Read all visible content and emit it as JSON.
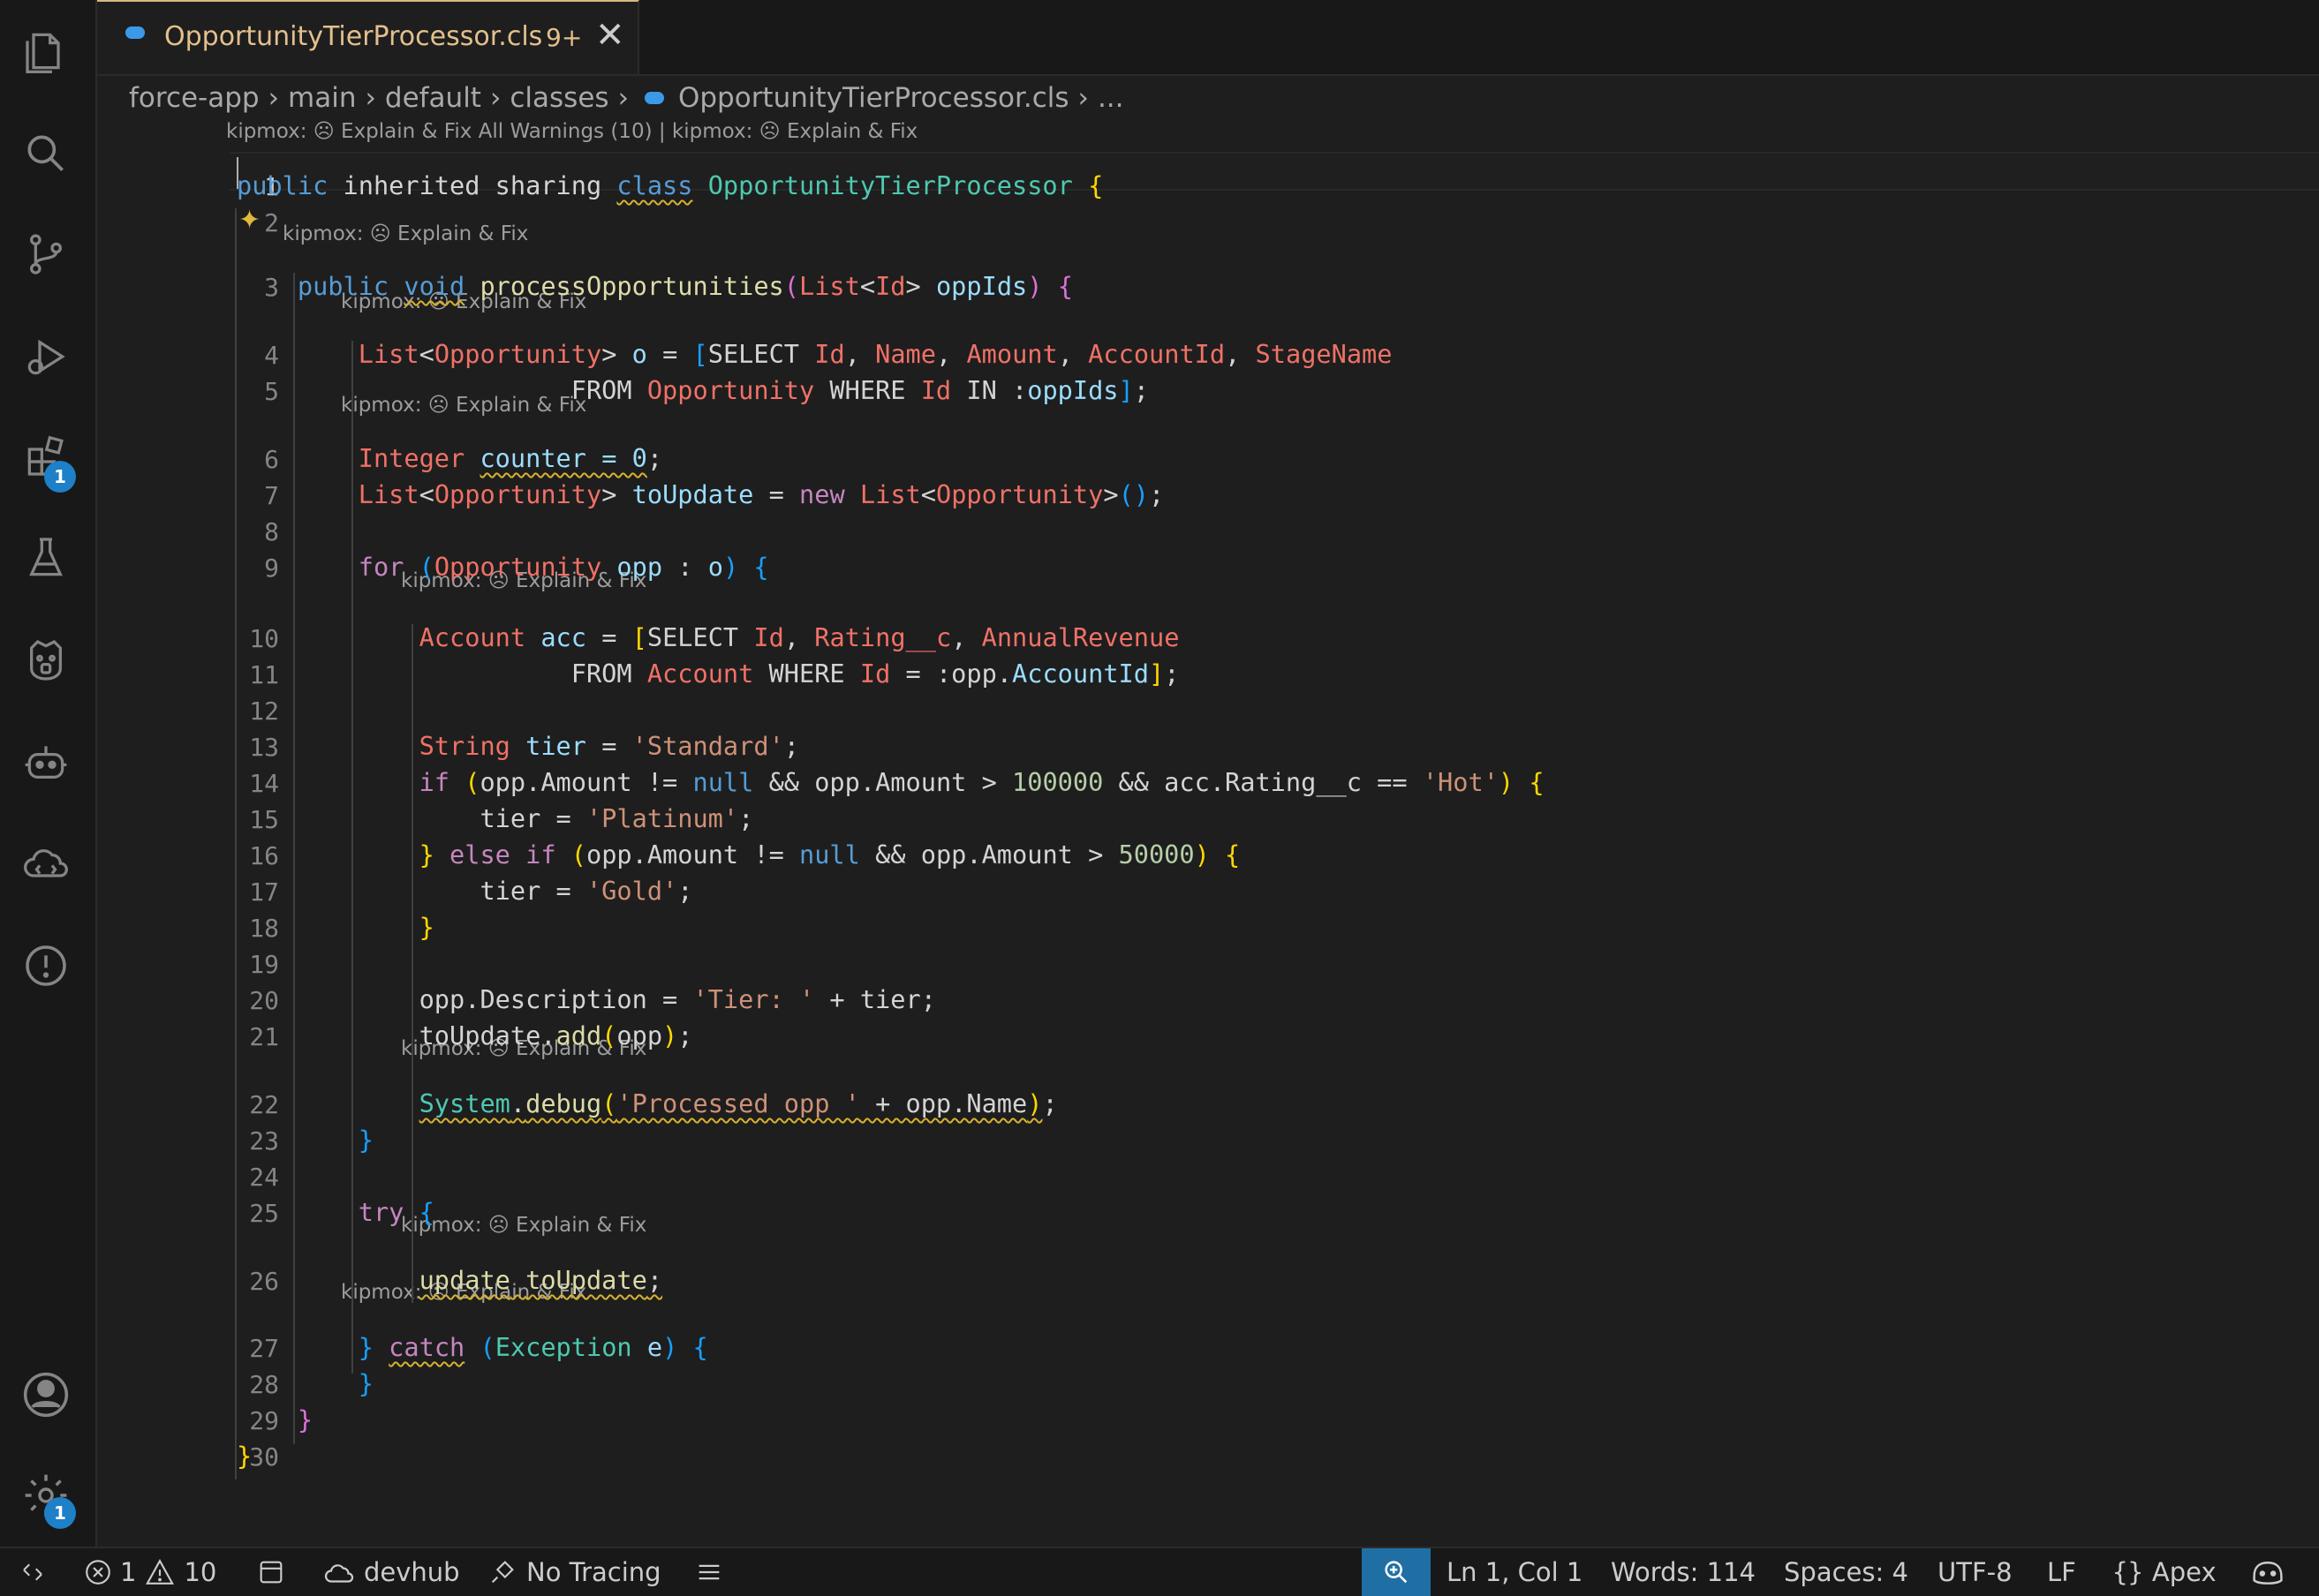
{
  "tab": {
    "filename": "OpportunityTierProcessor.cls",
    "problems": "9+",
    "close": "✕"
  },
  "breadcrumb": [
    "force-app",
    "main",
    "default",
    "classes",
    "OpportunityTierProcessor.cls",
    "..."
  ],
  "activity_badges": {
    "extensions": "1",
    "settings": "1"
  },
  "code_lens": {
    "top": "kipmox: ☹ Explain & Fix All Warnings (10) | kipmox: ☹ Explain & Fix",
    "fix": "kipmox: ☹ Explain & Fix"
  },
  "line_numbers": [
    "1",
    "2",
    "3",
    "4",
    "5",
    "6",
    "7",
    "8",
    "9",
    "10",
    "11",
    "12",
    "13",
    "14",
    "15",
    "16",
    "17",
    "18",
    "19",
    "20",
    "21",
    "22",
    "23",
    "24",
    "25",
    "26",
    "27",
    "28",
    "29",
    "30"
  ],
  "lines": [
    [
      [
        "public",
        "kw"
      ],
      [
        " inherited sharing ",
        ""
      ],
      [
        "class",
        "kw wv"
      ],
      [
        " ",
        ""
      ],
      [
        "OpportunityTierProcessor",
        "ty"
      ],
      [
        " ",
        ""
      ],
      [
        "{",
        "bk1"
      ]
    ],
    [],
    [
      [
        "    public ",
        "kw"
      ],
      [
        "void",
        "kw wv"
      ],
      [
        " ",
        ""
      ],
      [
        "processOpportunities",
        "fn"
      ],
      [
        "(",
        "bk2"
      ],
      [
        "List",
        "sf"
      ],
      [
        "<",
        ""
      ],
      [
        "Id",
        "sf"
      ],
      [
        "> ",
        ""
      ],
      [
        "oppIds",
        "var"
      ],
      [
        ")",
        "bk2"
      ],
      [
        " ",
        ""
      ],
      [
        "{",
        "bk2"
      ]
    ],
    [
      [
        "        ",
        ""
      ],
      [
        "List",
        "sf"
      ],
      [
        "<",
        ""
      ],
      [
        "Opportunity",
        "sf"
      ],
      [
        "> ",
        ""
      ],
      [
        "o",
        "var"
      ],
      [
        " = ",
        ""
      ],
      [
        "[",
        "bk3"
      ],
      [
        "SELECT ",
        ""
      ],
      [
        "Id",
        "sf"
      ],
      [
        ", ",
        ""
      ],
      [
        "Name",
        "sf"
      ],
      [
        ", ",
        ""
      ],
      [
        "Amount",
        "sf"
      ],
      [
        ", ",
        ""
      ],
      [
        "AccountId",
        "sf"
      ],
      [
        ", ",
        ""
      ],
      [
        "StageName",
        "sf"
      ]
    ],
    [
      [
        "                ",
        ""
      ],
      [
        "      FROM ",
        ""
      ],
      [
        "Opportunity",
        "sf"
      ],
      [
        " WHERE ",
        ""
      ],
      [
        "Id",
        "sf"
      ],
      [
        " IN :",
        ""
      ],
      [
        "oppIds",
        "var"
      ],
      [
        "]",
        "bk3"
      ],
      [
        ";",
        ""
      ]
    ],
    [
      [
        "        ",
        ""
      ],
      [
        "Integer",
        "sf"
      ],
      [
        " ",
        ""
      ],
      [
        "counter = 0",
        "var wv"
      ],
      [
        ";",
        ""
      ]
    ],
    [
      [
        "        ",
        ""
      ],
      [
        "List",
        "sf"
      ],
      [
        "<",
        ""
      ],
      [
        "Opportunity",
        "sf"
      ],
      [
        "> ",
        ""
      ],
      [
        "toUpdate",
        "var"
      ],
      [
        " = ",
        ""
      ],
      [
        "new",
        "ctl"
      ],
      [
        " ",
        ""
      ],
      [
        "List",
        "sf"
      ],
      [
        "<",
        ""
      ],
      [
        "Opportunity",
        "sf"
      ],
      [
        ">",
        ""
      ],
      [
        "()",
        "bk3"
      ],
      [
        ";",
        ""
      ]
    ],
    [],
    [
      [
        "        ",
        ""
      ],
      [
        "for",
        "ctl"
      ],
      [
        " ",
        ""
      ],
      [
        "(",
        "bk3"
      ],
      [
        "Opportunity",
        "sf"
      ],
      [
        " ",
        ""
      ],
      [
        "opp",
        "var"
      ],
      [
        " : ",
        ""
      ],
      [
        "o",
        "var"
      ],
      [
        ")",
        "bk3"
      ],
      [
        " ",
        ""
      ],
      [
        "{",
        "bk3"
      ]
    ],
    [
      [
        "            ",
        ""
      ],
      [
        "Account",
        "sf"
      ],
      [
        " ",
        ""
      ],
      [
        "acc",
        "var"
      ],
      [
        " = ",
        ""
      ],
      [
        "[",
        "bk1"
      ],
      [
        "SELECT ",
        ""
      ],
      [
        "Id",
        "sf"
      ],
      [
        ", ",
        ""
      ],
      [
        "Rating__c",
        "sf"
      ],
      [
        ", ",
        ""
      ],
      [
        "AnnualRevenue",
        "sf"
      ]
    ],
    [
      [
        "                ",
        ""
      ],
      [
        "      FROM ",
        ""
      ],
      [
        "Account",
        "sf"
      ],
      [
        " WHERE ",
        ""
      ],
      [
        "Id",
        "sf"
      ],
      [
        " = :opp.",
        ""
      ],
      [
        "AccountId",
        "var"
      ],
      [
        "]",
        "bk1"
      ],
      [
        ";",
        ""
      ]
    ],
    [],
    [
      [
        "            ",
        ""
      ],
      [
        "String",
        "sf"
      ],
      [
        " ",
        ""
      ],
      [
        "tier",
        "var"
      ],
      [
        " = ",
        ""
      ],
      [
        "'Standard'",
        "str"
      ],
      [
        ";",
        ""
      ]
    ],
    [
      [
        "            ",
        ""
      ],
      [
        "if",
        "ctl"
      ],
      [
        " ",
        ""
      ],
      [
        "(",
        "bk1"
      ],
      [
        "opp.Amount != ",
        ""
      ],
      [
        "null",
        "kw"
      ],
      [
        " && opp.Amount > ",
        ""
      ],
      [
        "100000",
        "num"
      ],
      [
        " && acc.Rating__c == ",
        ""
      ],
      [
        "'Hot'",
        "str"
      ],
      [
        ")",
        "bk1"
      ],
      [
        " ",
        ""
      ],
      [
        "{",
        "bk1"
      ]
    ],
    [
      [
        "                tier = ",
        ""
      ],
      [
        "'Platinum'",
        "str"
      ],
      [
        ";",
        ""
      ]
    ],
    [
      [
        "            ",
        ""
      ],
      [
        "}",
        "bk1"
      ],
      [
        " ",
        ""
      ],
      [
        "else if",
        "ctl"
      ],
      [
        " ",
        ""
      ],
      [
        "(",
        "bk1"
      ],
      [
        "opp.Amount != ",
        ""
      ],
      [
        "null",
        "kw"
      ],
      [
        " && opp.Amount > ",
        ""
      ],
      [
        "50000",
        "num"
      ],
      [
        ")",
        "bk1"
      ],
      [
        " ",
        ""
      ],
      [
        "{",
        "bk1"
      ]
    ],
    [
      [
        "                tier = ",
        ""
      ],
      [
        "'Gold'",
        "str"
      ],
      [
        ";",
        ""
      ]
    ],
    [
      [
        "            ",
        ""
      ],
      [
        "}",
        "bk1"
      ]
    ],
    [],
    [
      [
        "            opp.Description = ",
        ""
      ],
      [
        "'Tier: '",
        "str"
      ],
      [
        " + tier;",
        ""
      ]
    ],
    [
      [
        "            toUpdate.",
        ""
      ],
      [
        "add",
        "fn"
      ],
      [
        "(",
        "bk1"
      ],
      [
        "opp",
        ""
      ],
      [
        ")",
        "bk1"
      ],
      [
        ";",
        ""
      ]
    ],
    [
      [
        "            ",
        ""
      ],
      [
        "System",
        "ty wv"
      ],
      [
        ".",
        "wv"
      ],
      [
        "debug",
        "fn wv"
      ],
      [
        "(",
        "bk1 wv"
      ],
      [
        "'Processed opp '",
        "str wv"
      ],
      [
        " + opp.Name",
        "wv"
      ],
      [
        ")",
        "bk1 wv"
      ],
      [
        ";",
        ""
      ]
    ],
    [
      [
        "        ",
        ""
      ],
      [
        "}",
        "bk3"
      ]
    ],
    [],
    [
      [
        "        ",
        ""
      ],
      [
        "try",
        "ctl"
      ],
      [
        " ",
        ""
      ],
      [
        "{",
        "bk3"
      ]
    ],
    [
      [
        "            ",
        ""
      ],
      [
        "update",
        "fn wv"
      ],
      [
        " ",
        "wv"
      ],
      [
        "toUpdate",
        "fn wv"
      ],
      [
        ";",
        "wv"
      ]
    ],
    [
      [
        "        ",
        ""
      ],
      [
        "}",
        "bk3"
      ],
      [
        " ",
        ""
      ],
      [
        "catch",
        "ctl wv"
      ],
      [
        " ",
        ""
      ],
      [
        "(",
        "bk3"
      ],
      [
        "Exception",
        "ty"
      ],
      [
        " ",
        ""
      ],
      [
        "e",
        "var"
      ],
      [
        ")",
        "bk3"
      ],
      [
        " ",
        ""
      ],
      [
        "{",
        "bk3"
      ]
    ],
    [
      [
        "        ",
        ""
      ],
      [
        "}",
        "bk3"
      ]
    ],
    [
      [
        "    ",
        ""
      ],
      [
        "}",
        "bk2"
      ]
    ],
    [
      [
        "}",
        "bk1"
      ]
    ]
  ],
  "status": {
    "errors": "1",
    "warnings": "10",
    "org": "devhub",
    "tracing": "No Tracing",
    "position": "Ln 1, Col 1",
    "words": "Words: 114",
    "spaces": "Spaces: 4",
    "encoding": "UTF-8",
    "eol": "LF",
    "language": "Apex"
  },
  "colors": {
    "accent": "#d7ba7d",
    "badge": "#1d80c9",
    "status_zoom": "#1f6fa5"
  }
}
